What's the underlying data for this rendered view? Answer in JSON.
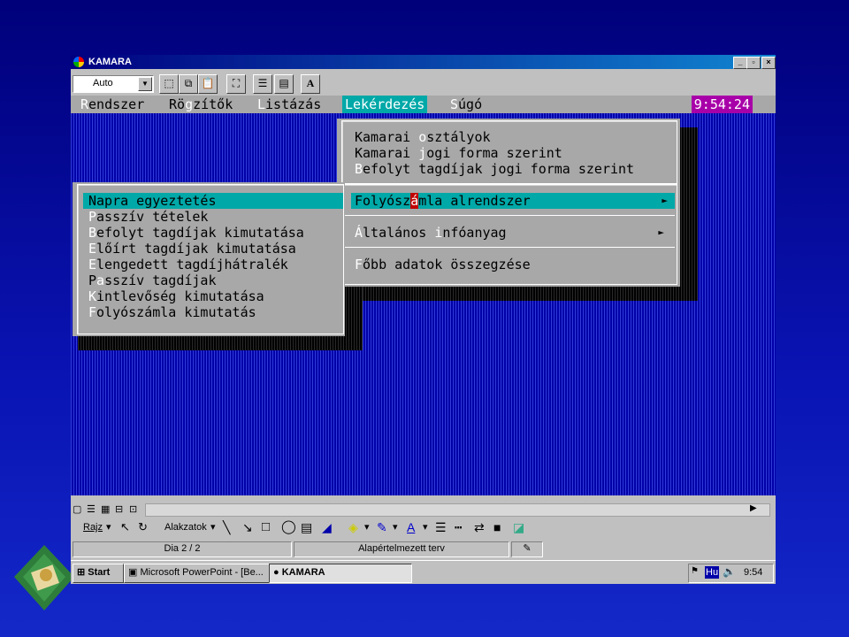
{
  "window": {
    "title": "KAMARA",
    "min": "_",
    "max": "▫",
    "close": "×"
  },
  "toolbar": {
    "zoom_value": "Auto",
    "font_button": "A"
  },
  "dos_app": {
    "menu": [
      {
        "hotkey": "R",
        "rest": "endszer"
      },
      {
        "pre": "Rö",
        "hotkey": "g",
        "rest": "zítők"
      },
      {
        "hotkey": "L",
        "rest": "istázás"
      },
      {
        "label": "Lekérdezés"
      },
      {
        "hotkey": "S",
        "rest": "úgó"
      }
    ],
    "clock": "9:54:24",
    "top_submenu": [
      {
        "pre": "Kamarai ",
        "hotkey": "o",
        "rest": "sztályok"
      },
      {
        "pre": "Kamarai ",
        "hotkey": "j",
        "rest": "ogi forma szerint"
      },
      {
        "hotkey": "B",
        "rest": "efolyt tagdíjak jogi forma szerint"
      }
    ],
    "lekerdezes_menu": [
      {
        "hotkey": "F",
        "pre": "olyósz",
        "red": "á",
        "rest": "mla alrendszer",
        "arrow": "►"
      },
      {
        "hotkey": "Á",
        "pre": "ltalános ",
        "mid_hotkey": "i",
        "rest": "nfóanyag",
        "arrow": "►"
      },
      {
        "hotkey": "F",
        "rest": "őbb adatok összegzése"
      }
    ],
    "left_submenu": [
      {
        "label": "Napra egyeztetés"
      },
      {
        "hotkey": "P",
        "rest": "asszív tételek"
      },
      {
        "hotkey": "B",
        "rest": "efolyt tagdíjak kimutatása"
      },
      {
        "hotkey": "E",
        "rest": "lőírt tagdíjak kimutatása"
      },
      {
        "hotkey": "E",
        "rest": "lengedett tagdíjhátralék"
      },
      {
        "pre": "P",
        "hotkey": "a",
        "rest": "sszív tagdíjak"
      },
      {
        "hotkey": "K",
        "rest": "intlevőség kimutatása"
      },
      {
        "hotkey": "F",
        "rest": "olyószámla kimutatás"
      }
    ]
  },
  "drawing_toolbar": {
    "draw_label": "Rajz",
    "shapes_label": "Alakzatok"
  },
  "statusbar": {
    "slide": "Dia 2 / 2",
    "template": "Alapértelmezett terv"
  },
  "taskbar": {
    "start": "Start",
    "items": [
      "Microsoft PowerPoint - [Be...",
      "KAMARA"
    ],
    "lang": "Hu",
    "time": "9:54"
  }
}
